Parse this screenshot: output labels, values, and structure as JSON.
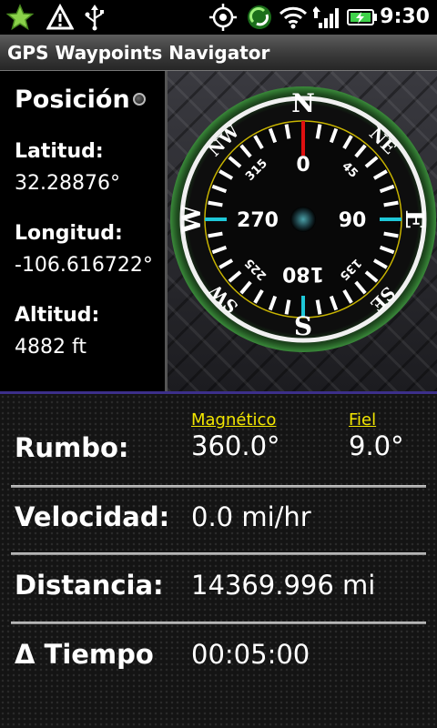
{
  "status_bar": {
    "time": "9:30",
    "icons": [
      "star-icon",
      "warning-icon",
      "usb-icon",
      "gps-icon",
      "sync-icon",
      "wifi-icon",
      "signal-icon",
      "battery-icon"
    ]
  },
  "app": {
    "title": "GPS Waypoints Navigator"
  },
  "position": {
    "header": "Posición",
    "lat_label": "Latitud:",
    "lat_value": "32.28876°",
    "lon_label": "Longitud:",
    "lon_value": "-106.616722°",
    "alt_label": "Altitud:",
    "alt_value": "4882 ft"
  },
  "compass": {
    "cardinals": [
      "N",
      "E",
      "S",
      "W"
    ],
    "intercardinals": [
      "NE",
      "SE",
      "SW",
      "NW"
    ],
    "degrees": [
      "0",
      "45",
      "90",
      "135",
      "180",
      "225",
      "270",
      "315"
    ],
    "heading": 0,
    "colors": {
      "north_needle": "#e01010",
      "cyan_ticks": "#1ec8d8",
      "yellow_ticks": "#f0e020",
      "rim_glow": "#2e7a2e"
    }
  },
  "data": {
    "magnetic_label": "Magnético",
    "true_label": "Fiel",
    "heading_label": "Rumbo:",
    "heading_magnetic": "360.0°",
    "heading_true": "9.0°",
    "speed_label": "Velocidad:",
    "speed_value": "0.0 mi/hr",
    "distance_label": "Distancia:",
    "distance_value": "14369.996 mi",
    "time_label": "Δ Tiempo",
    "time_value": "00:05:00"
  }
}
